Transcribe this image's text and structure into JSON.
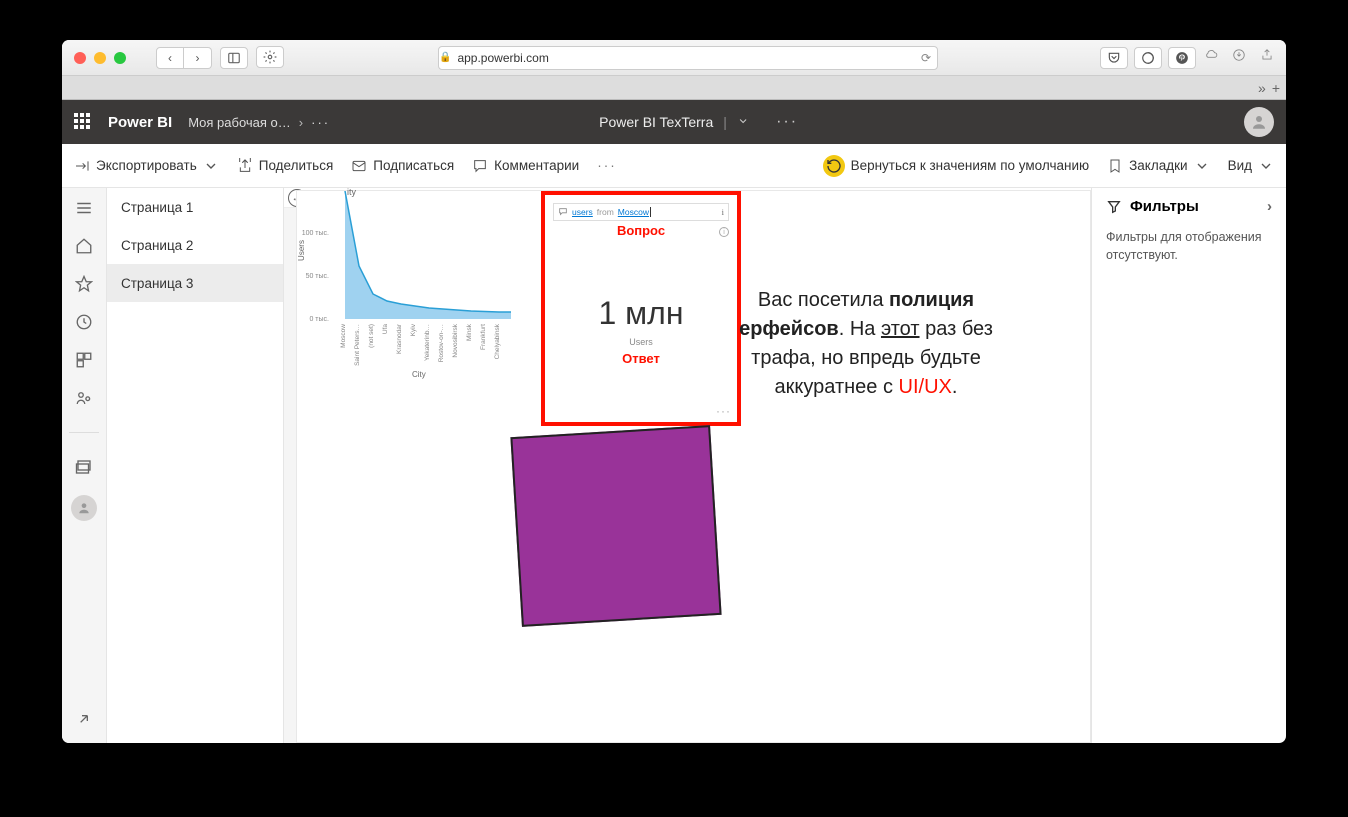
{
  "safari": {
    "url": "app.powerbi.com"
  },
  "pbi_header": {
    "app_name": "Power BI",
    "workspace": "Моя рабочая о…",
    "report_title": "Power BI TexTerra"
  },
  "action_bar": {
    "export": "Экспортировать",
    "share": "Поделиться",
    "subscribe": "Подписаться",
    "comments": "Комментарии",
    "reset": "Вернуться к значениям по умолчанию",
    "bookmarks": "Закладки",
    "view": "Вид"
  },
  "pages": {
    "items": [
      {
        "label": "Страница 1"
      },
      {
        "label": "Страница 2"
      },
      {
        "label": "Страница 3"
      }
    ]
  },
  "qa": {
    "query_prefix": "users",
    "query_from": "from",
    "query_city": "Moscow",
    "label_question": "Вопрос",
    "value": "1 млн",
    "sub": "Users",
    "label_answer": "Ответ"
  },
  "filters": {
    "title": "Фильтры",
    "empty": "Фильтры для отображения отсутствуют."
  },
  "overlay": {
    "t1": "Вас посетила ",
    "t2": "полиция",
    "t3": "ерфейсов",
    "t4": ". На ",
    "t5": "этот",
    "t6": " раз без",
    "t7": "трафа, но впредь будьте",
    "t8": "аккуратнее с ",
    "t9": "UI/UX",
    "t10": "."
  },
  "chart_data": {
    "type": "area",
    "title": "ity",
    "ylabel": "Users",
    "xlabel": "City",
    "ylim": [
      0,
      150000
    ],
    "yticks": [
      "0 тыс.",
      "50 тыс.",
      "100 тыс."
    ],
    "categories": [
      "Moscow",
      "Saint Peters…",
      "(not set)",
      "Ufa",
      "Krasnodar",
      "Kyiv",
      "Yekaterinb…",
      "Rostov-on-…",
      "Novosibirsk",
      "Minsk",
      "Frankfurt",
      "Chelyabinsk"
    ],
    "values": [
      150000,
      62000,
      30000,
      22000,
      18000,
      16000,
      14000,
      13000,
      12000,
      11000,
      10500,
      10000
    ]
  }
}
